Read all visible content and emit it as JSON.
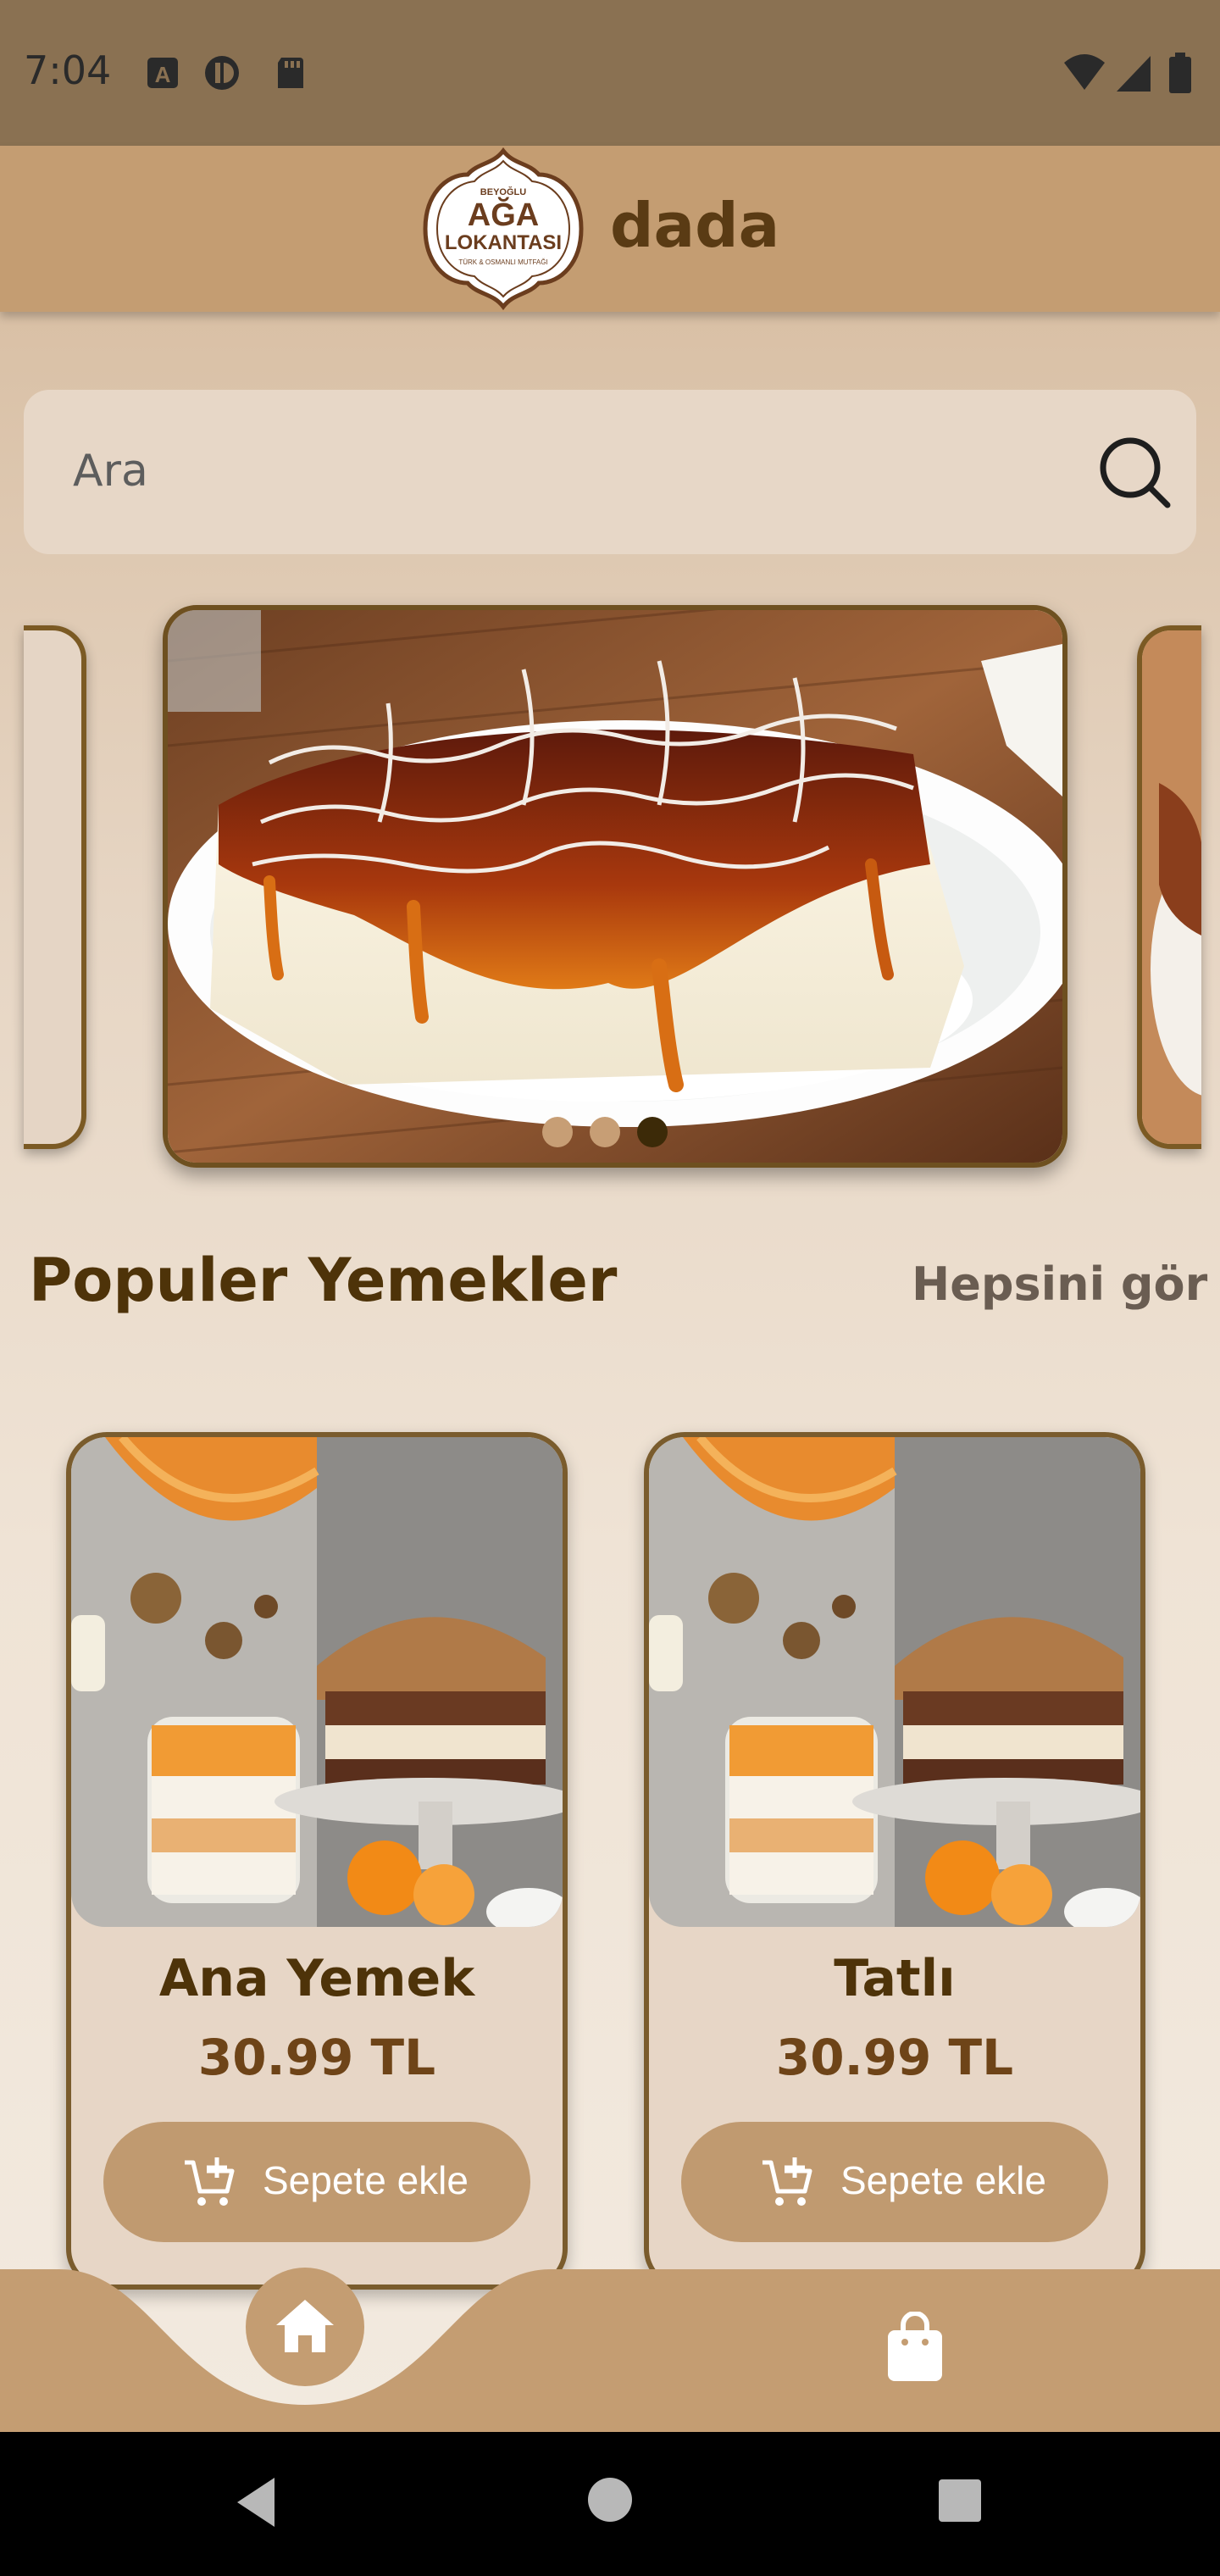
{
  "status_bar": {
    "time": "7:04",
    "left_icons": [
      "keyboard-a-icon",
      "pie-icon",
      "sd-card-icon"
    ],
    "right_icons": [
      "wifi-icon",
      "signal-icon",
      "battery-icon"
    ]
  },
  "app_bar": {
    "logo_top": "BEYOĞLU",
    "logo_main_line1": "AĞA",
    "logo_main_line2": "LOKANTASI",
    "logo_bottom": "TÜRK & OSMANLI MUTFAĞI",
    "title": "dada"
  },
  "search": {
    "placeholder": "Ara",
    "icon": "search-icon"
  },
  "carousel": {
    "slide_count": 3,
    "active_index": 2,
    "active_slide": "trileçe dessert image"
  },
  "section": {
    "title": "Populer Yemekler",
    "see_all": "Hepsini gör"
  },
  "products": [
    {
      "name": "Ana Yemek",
      "price": "30.99 TL",
      "button": "Sepete ekle"
    },
    {
      "name": "Tatlı",
      "price": "30.99 TL",
      "button": "Sepete ekle"
    }
  ],
  "bottom_nav": {
    "items": [
      {
        "icon": "home-icon",
        "active": true
      },
      {
        "icon": "shopping-bag-icon",
        "active": false
      }
    ]
  },
  "colors": {
    "status_bar": "#8a7152",
    "app_bar": "#c49d72",
    "brown_text": "#4e3309",
    "button": "#c09a70",
    "card_bg": "#e7d6c6"
  }
}
